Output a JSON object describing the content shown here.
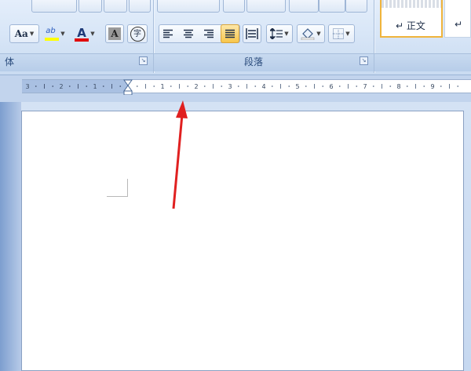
{
  "ribbon": {
    "font_group": {
      "label": "体",
      "change_case_label": "Aa",
      "highlight_label": "ab",
      "font_color_label": "A",
      "char_shading_label": "A",
      "enclose_char_label": "字"
    },
    "paragraph_group": {
      "label": "段落"
    },
    "styles_group": {
      "normal_style_label": "↵ 正文",
      "next_style_label": "↵"
    }
  },
  "ruler": {
    "left_numbers": [
      "3",
      "2",
      "1"
    ],
    "right_numbers": [
      "1",
      "2",
      "3",
      "4",
      "5",
      "6",
      "7",
      "8",
      "9"
    ]
  },
  "colors": {
    "ribbon": "#d8e6f7",
    "accent_highlight": "#f7c64c",
    "arrow": "#e02020",
    "font_color_bar": "#e00000",
    "highlight_bar": "#ffff00"
  }
}
